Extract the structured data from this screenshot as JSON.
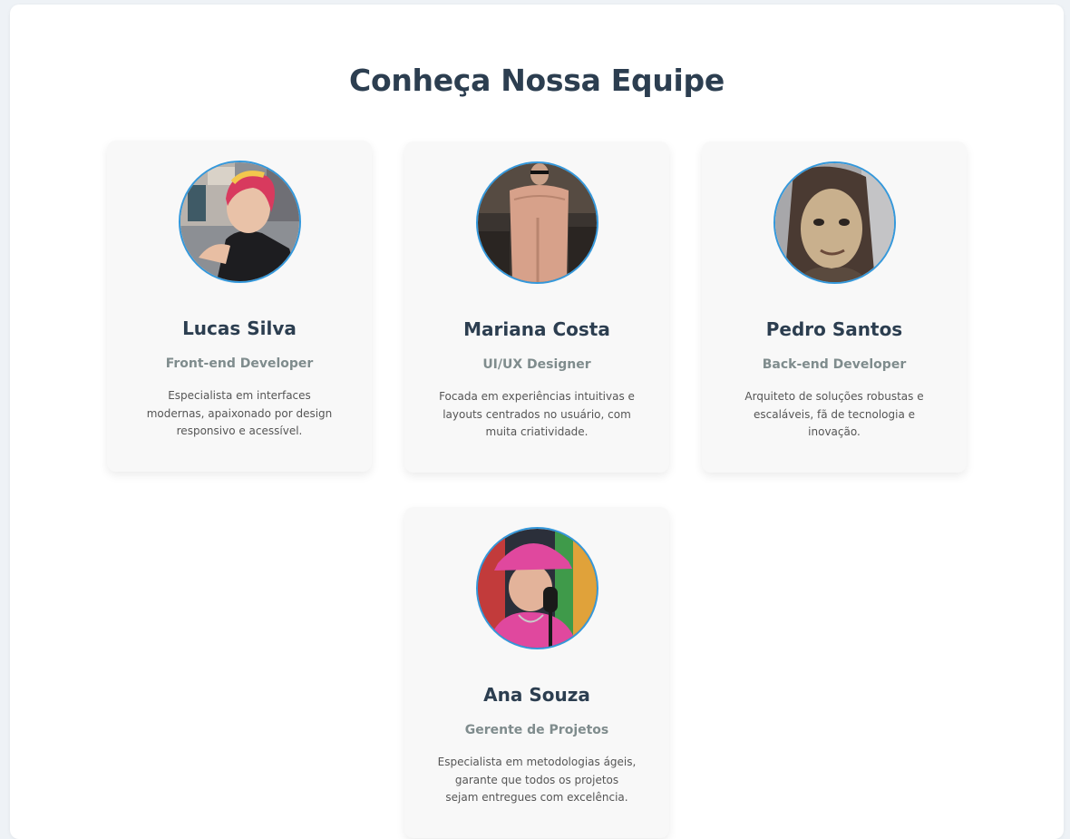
{
  "page": {
    "title": "Conheça Nossa Equipe"
  },
  "colors": {
    "heading": "#2c3e50",
    "role": "#7f8c8d",
    "text": "#555555",
    "avatar_border": "#3498db",
    "card_bg": "#f8f8f8"
  },
  "team": [
    {
      "name": "Lucas Silva",
      "role": "Front-end Developer",
      "description": "Especialista em interfaces modernas, apaixonado por design responsivo e acessível."
    },
    {
      "name": "Mariana Costa",
      "role": "UI/UX Designer",
      "description": "Focada em experiências intuitivas e layouts centrados no usuário, com muita criatividade."
    },
    {
      "name": "Pedro Santos",
      "role": "Back-end Developer",
      "description": "Arquiteto de soluções robustas e escaláveis, fã de tecnologia e inovação."
    },
    {
      "name": "Ana Souza",
      "role": "Gerente de Projetos",
      "description": "Especialista em metodologias ágeis, garante que todos os projetos sejam entregues com excelência."
    }
  ]
}
